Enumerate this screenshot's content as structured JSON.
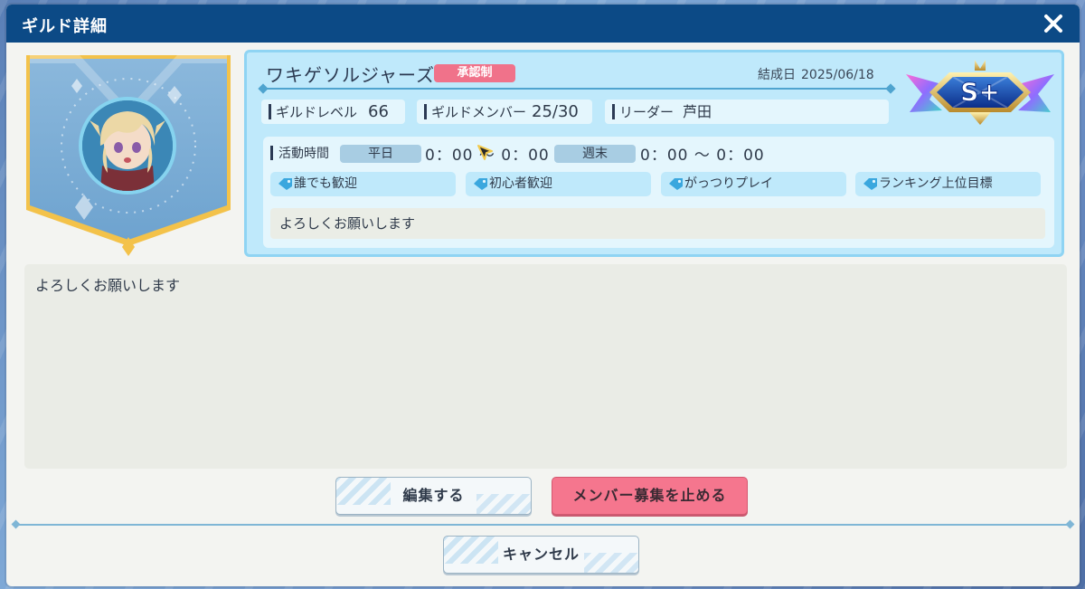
{
  "dialog": {
    "title": "ギルド詳細",
    "close_label": "✕"
  },
  "guild": {
    "name": "ワキゲソルジャーズ",
    "join_policy": "承認制",
    "founded_label": "結成日",
    "founded_date": "2025/06/18",
    "rank": "S+",
    "stats": {
      "level_label": "ギルドレベル",
      "level_value": "66",
      "members_label": "ギルドメンバー",
      "members_value": "25/30",
      "leader_label": "リーダー",
      "leader_value": "芦田"
    },
    "activity": {
      "label": "活動時間",
      "weekday_label": "平日",
      "weekday_time": "0：00 〜 0：00",
      "weekend_label": "週末",
      "weekend_time": "0：00 〜 0：00"
    },
    "tags": [
      "誰でも歓迎",
      "初心者歓迎",
      "がっつりプレイ",
      "ランキング上位目標"
    ],
    "short_message": "よろしくお願いします",
    "message": "よろしくお願いします"
  },
  "buttons": {
    "edit": "編集する",
    "stop_recruit": "メンバー募集を止める",
    "cancel": "キャンセル"
  },
  "colors": {
    "title_bar": "#0c4a86",
    "info_panel": "#bfe9fb",
    "badge": "#f0728a",
    "pink_button": "#f5768e"
  }
}
